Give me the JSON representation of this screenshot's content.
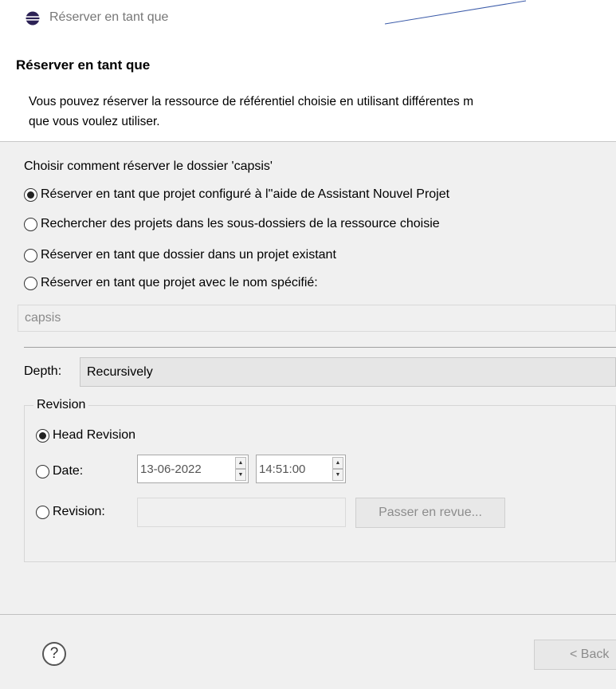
{
  "window": {
    "title": "Réserver en tant que"
  },
  "header": {
    "title": "Réserver en tant que",
    "description_line1": "Vous pouvez réserver la ressource de référentiel choisie en utilisant différentes m",
    "description_line2": "que vous voulez utiliser."
  },
  "options": {
    "prompt": "Choisir comment réserver le dossier 'capsis'",
    "radios": [
      {
        "label": "Réserver en tant que projet configuré à l''aide de Assistant Nouvel Projet",
        "selected": true
      },
      {
        "label": "Rechercher des projets dans les sous-dossiers de la ressource choisie",
        "selected": false
      },
      {
        "label": "Réserver en tant que dossier dans un projet existant",
        "selected": false
      },
      {
        "label": "Réserver en tant que  projet avec le nom spécifié:",
        "selected": false
      }
    ],
    "project_name_value": "capsis"
  },
  "depth": {
    "label": "Depth:",
    "value": "Recursively"
  },
  "revision": {
    "group_label": "Revision",
    "head_label": "Head Revision",
    "head_selected": true,
    "date_label": "Date:",
    "date_value": "13-06-2022",
    "time_value": "14:51:00",
    "revision_label": "Revision:",
    "revision_value": "",
    "browse_button": "Passer en revue..."
  },
  "footer": {
    "help_symbol": "?",
    "back_button": "< Back"
  },
  "colors": {
    "eclipse_icon_dark": "#2c2255",
    "eclipse_icon_stripe": "#ffffff",
    "title_line": "#3b5ba9"
  }
}
